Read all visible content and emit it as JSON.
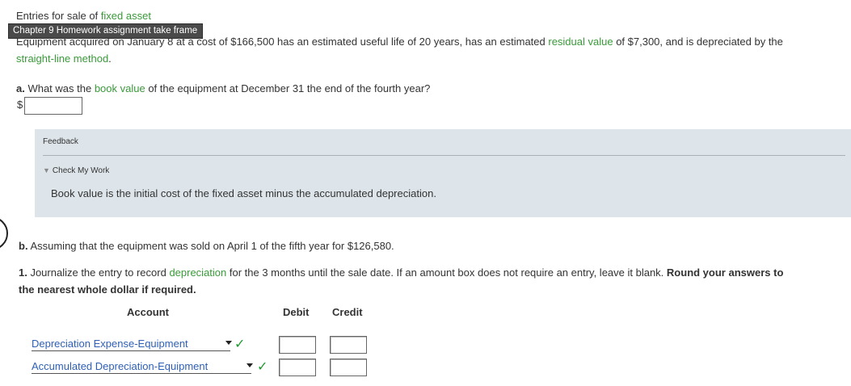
{
  "header": {
    "title_prefix": "Entries for sale of ",
    "title_link": "fixed asset",
    "tooltip": "Chapter 9 Homework assignment take frame"
  },
  "intro": {
    "t1": "Equipment acquired on January 8 at a cost of $166,500 has an estimated useful life of 20 years, has an estimated ",
    "link1": "residual value",
    "t2": " of $7,300, and is depreciated by the",
    "link2": "straight-line method",
    "t3": "."
  },
  "question_a": {
    "label": "a.",
    "t1": " What was the ",
    "link": "book value",
    "t2": " of the equipment at December 31 the end of the fourth year?",
    "currency": "$",
    "answer_value": ""
  },
  "feedback": {
    "title": "Feedback",
    "toggle_label": "Check My Work",
    "text": "Book value is the initial cost of the fixed asset minus the accumulated depreciation."
  },
  "question_b": {
    "label": "b.",
    "text": " Assuming that the equipment was sold on April 1 of the fifth year for $126,580."
  },
  "instruction_1": {
    "label": "1.",
    "t1": " Journalize the entry to record ",
    "link": "depreciation",
    "t2": " for the 3 months until the sale date. If an amount box does not require an entry, leave it blank. ",
    "bold_a": "Round your answers to",
    "bold_b": "the nearest whole dollar if required."
  },
  "journal": {
    "headers": {
      "account": "Account",
      "debit": "Debit",
      "credit": "Credit"
    },
    "rows": [
      {
        "account": "Depreciation Expense-Equipment",
        "status_icon": "check-icon",
        "debit": "",
        "credit": ""
      },
      {
        "account": "Accumulated Depreciation-Equipment",
        "status_icon": "check-icon",
        "debit": "",
        "credit": ""
      }
    ]
  },
  "colors": {
    "link_green": "#3a9a3a",
    "check_green": "#1f9a2f",
    "select_blue": "#2f5fb5",
    "feedback_bg": "#dde5ea"
  }
}
